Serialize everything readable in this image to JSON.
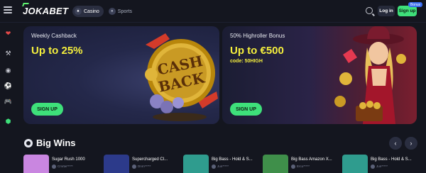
{
  "header": {
    "logo_text": "JOKABET",
    "tabs": [
      {
        "label": "Casino",
        "active": true,
        "icon": "cards-icon"
      },
      {
        "label": "Sports",
        "active": false,
        "icon": "ball-icon"
      }
    ],
    "login_label": "Log in",
    "signup_label": "Sign up",
    "bonus_badge": "Bonus"
  },
  "sidebar": {
    "icons": [
      "lips-icon",
      "tools-icon",
      "broadcast-icon",
      "soccer-ball-icon",
      "gamepad-icon",
      "trophy-icon"
    ]
  },
  "promos": [
    {
      "subtitle": "Weekly Cashback",
      "title": "Up to 25%",
      "code": "",
      "button": "SIGN UP",
      "art_text_1": "CASH",
      "art_text_2": "BACK"
    },
    {
      "subtitle": "50% Highroller Bonus",
      "title": "Up to €500",
      "code": "code: 50HIGH",
      "button": "SIGN UP"
    }
  ],
  "big_wins": {
    "title": "Big Wins",
    "cards": [
      {
        "game": "Sugar Rush 1000",
        "user": "Cmrtw*****",
        "color": "#c986e0"
      },
      {
        "game": "Supercharged Cl...",
        "user": "Dnrn*****",
        "color": "#2c3a8a"
      },
      {
        "game": "Big Bass - Hold & S...",
        "user": "Jun*****",
        "color": "#2f9c8e"
      },
      {
        "game": "Big Bass Amazon X...",
        "user": "Erco*****",
        "color": "#3f8f4a"
      },
      {
        "game": "Big Bass - Hold & S...",
        "user": "Jun*****",
        "color": "#2f9c8e"
      }
    ]
  },
  "colors": {
    "accent": "#3ee07a",
    "promo_title": "#f4ee3d",
    "background": "#14161f"
  }
}
